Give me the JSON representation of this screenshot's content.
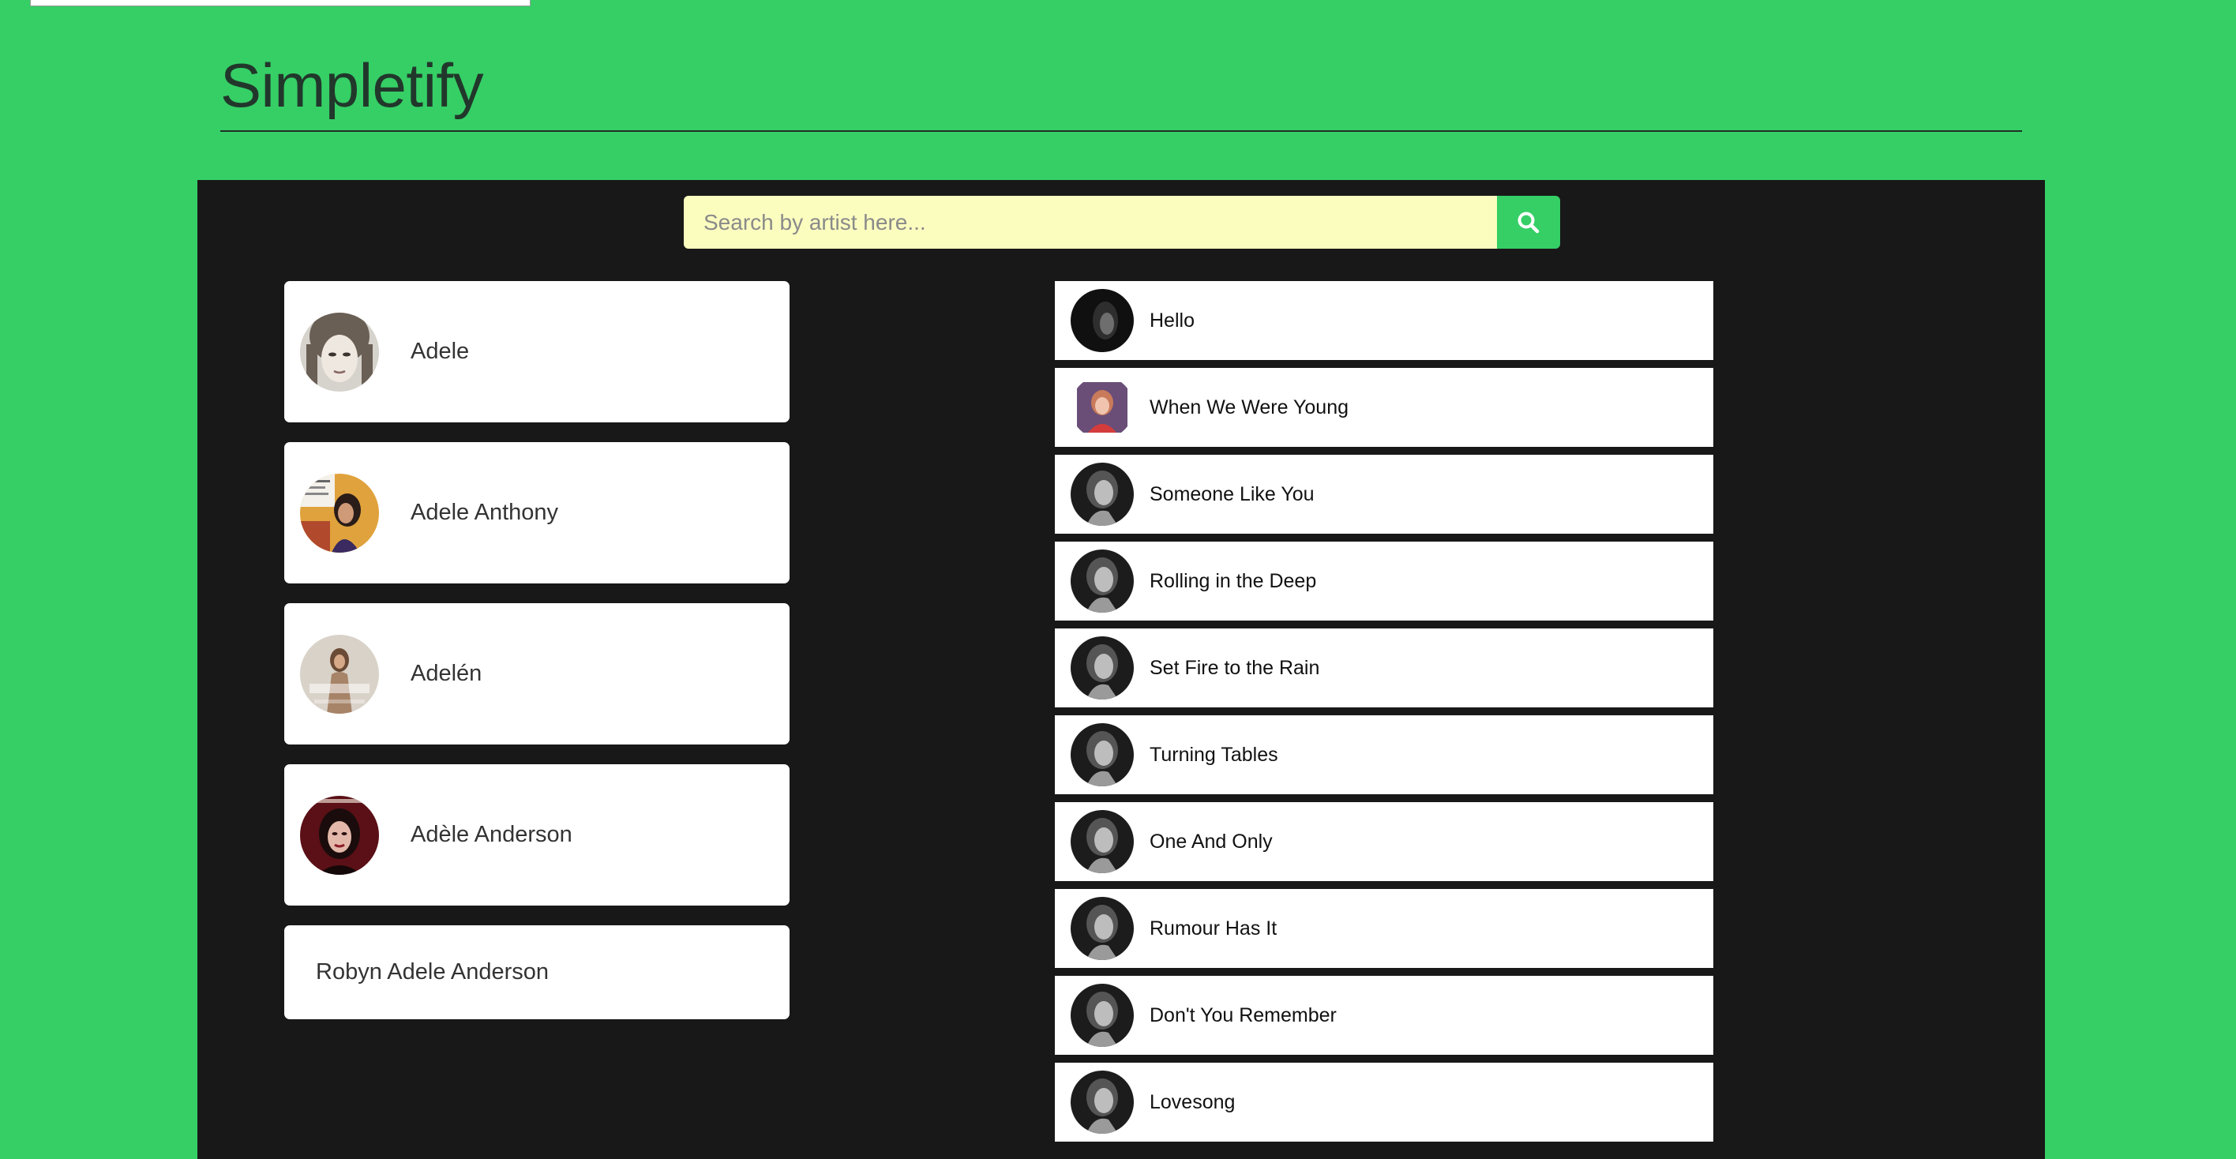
{
  "app": {
    "title": "Simpletify"
  },
  "search": {
    "placeholder": "Search by artist here...",
    "value": "",
    "button_icon": "search-icon"
  },
  "artists": [
    {
      "name": "Adele",
      "has_image": true
    },
    {
      "name": "Adele Anthony",
      "has_image": true
    },
    {
      "name": "Adelén",
      "has_image": true
    },
    {
      "name": "Adèle Anderson",
      "has_image": true
    },
    {
      "name": "Robyn Adele Anderson",
      "has_image": false
    }
  ],
  "tracks": [
    {
      "name": "Hello"
    },
    {
      "name": "When We Were Young"
    },
    {
      "name": "Someone Like You"
    },
    {
      "name": "Rolling in the Deep"
    },
    {
      "name": "Set Fire to the Rain"
    },
    {
      "name": "Turning Tables"
    },
    {
      "name": "One And Only"
    },
    {
      "name": "Rumour Has It"
    },
    {
      "name": "Don't You Remember"
    },
    {
      "name": "Lovesong"
    }
  ],
  "colors": {
    "brand_green": "#35cf66",
    "panel_dark": "#181818",
    "search_bg": "#fbfdbf",
    "card_bg": "#ffffff"
  }
}
